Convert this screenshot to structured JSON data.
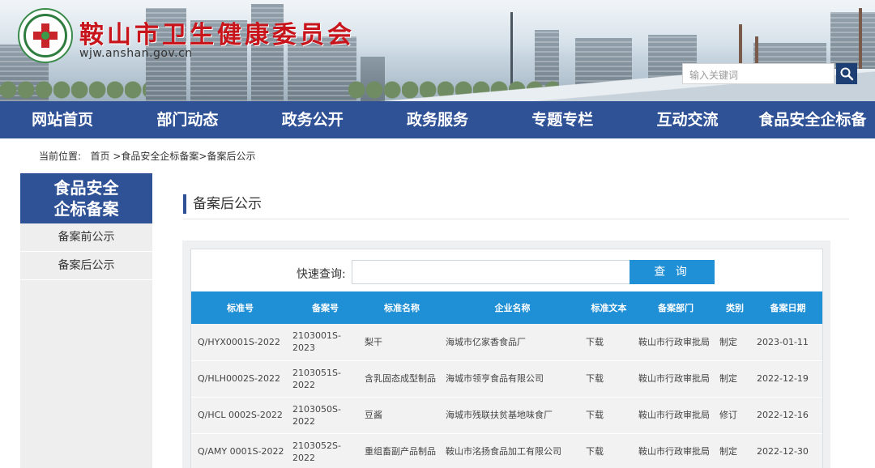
{
  "header": {
    "site_title": "鞍山市卫生健康委员会",
    "site_url": "wjw.anshan.gov.cn",
    "search_placeholder": "输入关键词"
  },
  "nav": {
    "items": [
      "网站首页",
      "部门动态",
      "政务公开",
      "政务服务",
      "专题专栏",
      "互动交流",
      "食品安全企标备"
    ]
  },
  "breadcrumb": {
    "label": "当前位置:",
    "home": "首页",
    "path": " >食品安全企标备案>备案后公示"
  },
  "sidebar": {
    "title_line1": "食品安全",
    "title_line2": "企标备案",
    "items": [
      "备案前公示",
      "备案后公示"
    ]
  },
  "content": {
    "section_title": "备案后公示",
    "quick_search_label": "快速查询:",
    "quick_search_button": "查 询",
    "table": {
      "headers": [
        "标准号",
        "备案号",
        "标准名称",
        "企业名称",
        "标准文本",
        "备案部门",
        "类别",
        "备案日期"
      ],
      "rows": [
        [
          "Q/HYX0001S-2022",
          "2103001S-2023",
          "梨干",
          "海城市亿家香食品厂",
          "下载",
          "鞍山市行政审批局",
          "制定",
          "2023-01-11"
        ],
        [
          "Q/HLH0002S-2022",
          "2103051S-2022",
          "含乳固态成型制品",
          "海城市领亨食品有限公司",
          "下载",
          "鞍山市行政审批局",
          "制定",
          "2022-12-19"
        ],
        [
          "Q/HCL 0002S-2022",
          "2103050S-2022",
          "豆酱",
          "海城市残联扶贫基地味食厂",
          "下载",
          "鞍山市行政审批局",
          "修订",
          "2022-12-16"
        ],
        [
          "Q/AMY 0001S-2022",
          "2103052S-2022",
          "重组畜副产品制品",
          "鞍山市洺扬食品加工有限公司",
          "下载",
          "鞍山市行政审批局",
          "制定",
          "2022-12-30"
        ]
      ]
    }
  },
  "colors": {
    "nav_bg": "#2f5296",
    "table_header_bg": "#1f8fd6",
    "title_red": "#c8141b"
  }
}
